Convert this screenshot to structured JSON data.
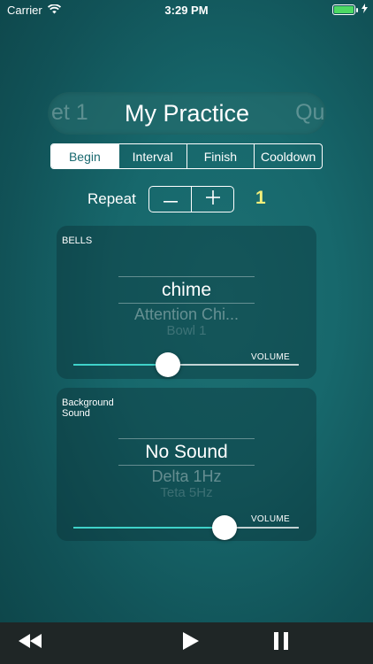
{
  "status_bar": {
    "carrier": "Carrier",
    "time": "3:29 PM",
    "battery_color": "#4cd964"
  },
  "practice": {
    "previous": "et 1",
    "title": "My Practice",
    "next": "Qui"
  },
  "segments": [
    {
      "label": "Begin",
      "active": true
    },
    {
      "label": "Interval",
      "active": false
    },
    {
      "label": "Finish",
      "active": false
    },
    {
      "label": "Cooldown",
      "active": false
    }
  ],
  "repeat": {
    "label": "Repeat",
    "value": "1",
    "value_color": "#f3ef7a"
  },
  "bells": {
    "label": "BELLS",
    "selected": "chime",
    "next1": "Attention Chi...",
    "next2": "Bowl 1",
    "volume_label": "VOLUME",
    "volume": 0.42
  },
  "background_sound": {
    "label": "Background Sound",
    "selected": "No Sound",
    "next1": "Delta 1Hz",
    "next2": "Teta 5Hz",
    "volume_label": "VOLUME",
    "volume": 0.67
  },
  "toolbar": {
    "icons": [
      "rewind-icon",
      "play-icon",
      "pause-icon"
    ]
  },
  "colors": {
    "accent": "#3fd2c9",
    "toolbar_bg": "#1f2626"
  }
}
